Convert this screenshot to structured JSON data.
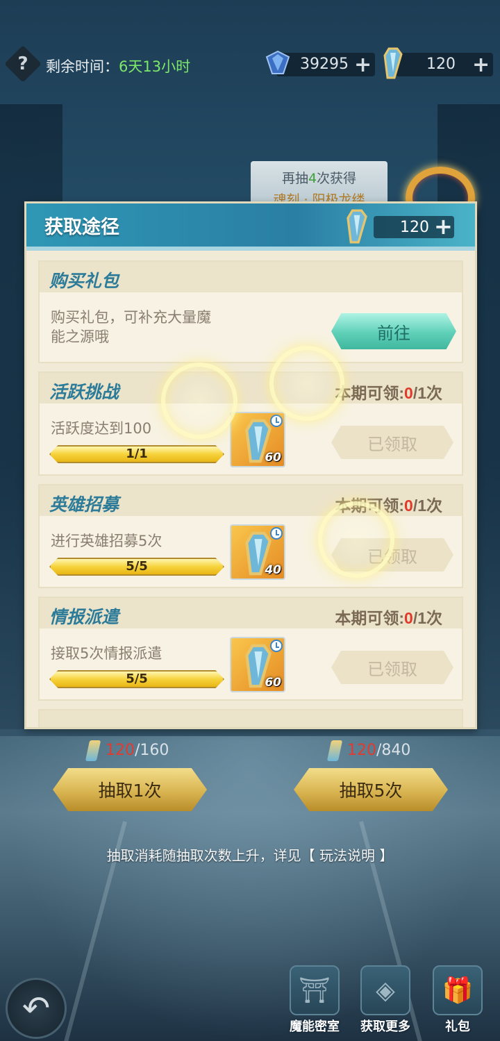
{
  "top_bar": {
    "help_icon": "question-mark-icon",
    "timer_label": "剩余时间：",
    "timer_value": "6天13小时",
    "diamond": {
      "icon": "diamond-icon",
      "value": "39295"
    },
    "crystal": {
      "icon": "crystal-ticket-icon",
      "value": "120"
    }
  },
  "banner": {
    "line1_prefix": "再抽",
    "line1_count": "4",
    "line1_suffix": "次获得",
    "line2": "魂刻 · 阳极龙缕"
  },
  "panel": {
    "title": "获取途径",
    "currency_value": "120",
    "sections": [
      {
        "title": "购买礼包",
        "desc_line1": "购买礼包，可补充大量魔",
        "desc_line2": "能之源哦",
        "button": "前往"
      },
      {
        "title": "活跃挑战",
        "quota_label": "本期可领:",
        "quota_current": "0",
        "quota_total": "/1次",
        "task": "活跃度达到100",
        "progress_text": "1/1",
        "progress": 1.0,
        "reward_count": "60",
        "button": "已领取"
      },
      {
        "title": "英雄招募",
        "quota_label": "本期可领:",
        "quota_current": "0",
        "quota_total": "/1次",
        "task": "进行英雄招募5次",
        "progress_text": "5/5",
        "progress": 1.0,
        "reward_count": "40",
        "button": "已领取"
      },
      {
        "title": "情报派遣",
        "quota_label": "本期可领:",
        "quota_current": "0",
        "quota_total": "/1次",
        "task": "接取5次情报派遣",
        "progress_text": "5/5",
        "progress": 1.0,
        "reward_count": "60",
        "button": "已领取"
      }
    ]
  },
  "draw": {
    "single": {
      "cost_have": "120",
      "cost_need": "/160",
      "label": "抽取1次"
    },
    "five": {
      "cost_have": "120",
      "cost_need": "/840",
      "label": "抽取5次"
    },
    "note": "抽取消耗随抽取次数上升，详见【 玩法说明 】"
  },
  "bottom_nav": {
    "back_icon": "back-arrow-icon",
    "items": [
      {
        "icon": "chest-icon",
        "label": "魔能密室"
      },
      {
        "icon": "diamond-frame-icon",
        "label": "获取更多"
      },
      {
        "icon": "gift-icon",
        "label": "礼包"
      }
    ]
  },
  "colors": {
    "timer_green": "#7ee86a",
    "quota_red": "#e03a2a",
    "section_title_blue": "#2c7b98",
    "go_button_teal": "#5fd0b8"
  }
}
